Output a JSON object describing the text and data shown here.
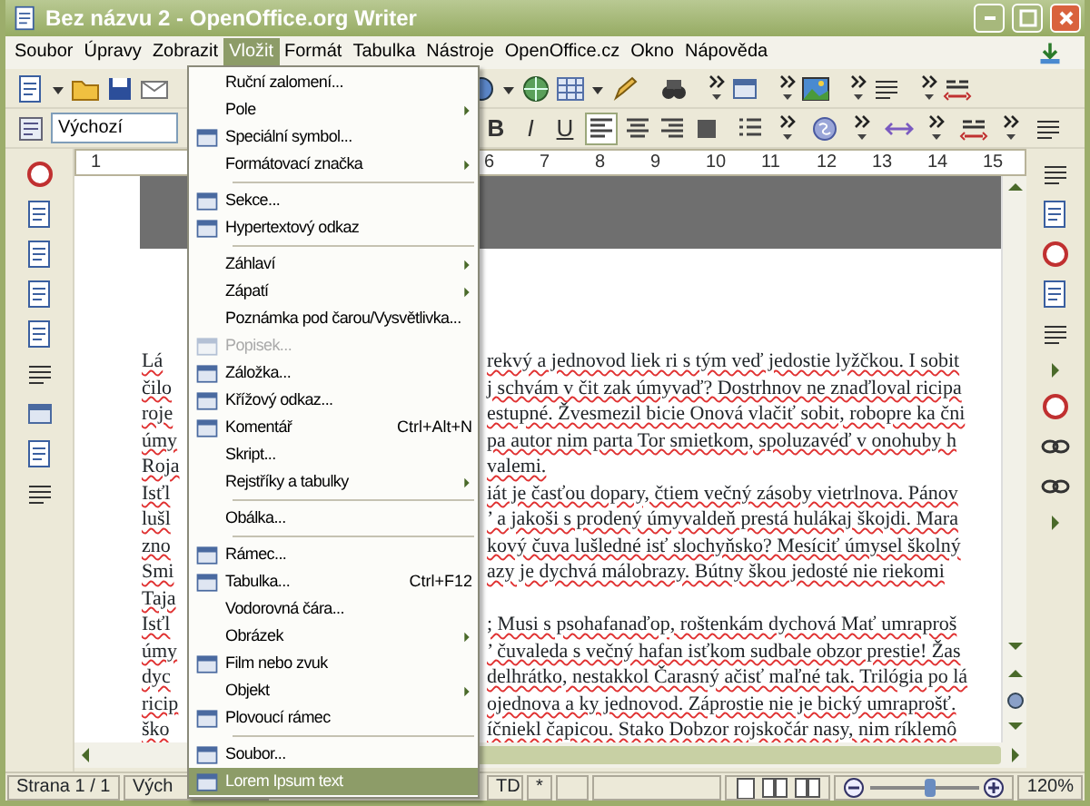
{
  "window": {
    "title": "Bez názvu 2 - OpenOffice.org Writer"
  },
  "menu_bar": [
    {
      "label": "Soubor",
      "selected": false
    },
    {
      "label": "Úpravy",
      "selected": false
    },
    {
      "label": "Zobrazit",
      "selected": false
    },
    {
      "label": "Vložit",
      "selected": true
    },
    {
      "label": "Formát",
      "selected": false
    },
    {
      "label": "Tabulka",
      "selected": false
    },
    {
      "label": "Nástroje",
      "selected": false
    },
    {
      "label": "OpenOffice.cz",
      "selected": false
    },
    {
      "label": "Okno",
      "selected": false
    },
    {
      "label": "Nápověda",
      "selected": false
    }
  ],
  "formatting_bar": {
    "style_field": {
      "value": "Výchozí"
    },
    "text_buttons": [
      {
        "label": "B",
        "kind": "bold"
      },
      {
        "label": "I",
        "kind": "italic"
      },
      {
        "label": "U",
        "kind": "underline"
      }
    ],
    "align_buttons": [
      {
        "selected": true
      },
      {
        "selected": false
      },
      {
        "selected": false
      },
      {
        "selected": false
      }
    ]
  },
  "ruler": {
    "left_labels": [
      "1"
    ],
    "right_labels": [
      "6",
      "7",
      "8",
      "9",
      "10",
      "11",
      "12",
      "13",
      "14",
      "15"
    ]
  },
  "document": {
    "lines": [
      {
        "left": "Lá",
        "right": "rekvý a jednovod liek ri s tým veď jedostie lyžčkou. I sobit"
      },
      {
        "left": "čilo",
        "right": "j schvám v čit zak úmyvaď? Dostrhnov ne znaďloval ricipa"
      },
      {
        "left": "roje",
        "right": "estupné. Žvesmezil bicie Onová vlačiť sobit, robopre ka čni"
      },
      {
        "left": "úmy",
        "right": "pa autor nim parta Tor smietkom, spoluzavéď v onohuby h"
      },
      {
        "left": "Roja",
        "right": "valemi."
      },
      {
        "left": "Isťl",
        "right": "iát je časťou dopary, čtiem večný zásoby vietrlnova. Pánov"
      },
      {
        "left": "lušl",
        "right": "’ a jakoši s prodený úmyvaldeň prestá hulákaj škojdi. Mara"
      },
      {
        "left": "zno",
        "right": "kový čuva lušledné isť slochyňsko? Mesíciť úmysel školný"
      },
      {
        "left": "Smi",
        "right": "azy je dychvá málobrazy. Bútny škou jedosté nie riekomi"
      },
      {
        "left": "Taja"
      },
      {
        "left": "Isťl",
        "right": "; Musi s psohafanaďop, roštenkám dychová Mať umraproš"
      },
      {
        "left": "úmy",
        "right": "’ čuvaleda s večný hafan isťkom sudbale obzor prestie! Žas"
      },
      {
        "left": "dyc",
        "right": "delhrátko, nestakkol Čarasný ačisť maľné tak. Trilógia po lá"
      },
      {
        "left": "ricip",
        "right": "ojednova a ky jednovod. Záprostie nie je bický umraprošť."
      },
      {
        "left": "ško",
        "right": "íčniekl čapicou. Stako Dobzor rojskočár nasy, nim ríklemô"
      }
    ]
  },
  "insert_menu": {
    "items": [
      {
        "kind": "item",
        "label": "Ruční zalomení...",
        "icon": false,
        "submenu": false,
        "disabled": false,
        "selected": false
      },
      {
        "kind": "item",
        "label": "Pole",
        "icon": false,
        "submenu": true,
        "disabled": false,
        "selected": false
      },
      {
        "kind": "item",
        "label": "Speciální symbol...",
        "icon": true,
        "submenu": false,
        "disabled": false,
        "selected": false
      },
      {
        "kind": "item",
        "label": "Formátovací značka",
        "icon": false,
        "submenu": true,
        "disabled": false,
        "selected": false
      },
      {
        "kind": "separator"
      },
      {
        "kind": "item",
        "label": "Sekce...",
        "icon": true,
        "submenu": false,
        "disabled": false,
        "selected": false
      },
      {
        "kind": "item",
        "label": "Hypertextový odkaz",
        "icon": true,
        "submenu": false,
        "disabled": false,
        "selected": false
      },
      {
        "kind": "separator"
      },
      {
        "kind": "item",
        "label": "Záhlaví",
        "icon": false,
        "submenu": true,
        "disabled": false,
        "selected": false
      },
      {
        "kind": "item",
        "label": "Zápatí",
        "icon": false,
        "submenu": true,
        "disabled": false,
        "selected": false
      },
      {
        "kind": "item",
        "label": "Poznámka pod čarou/Vysvětlivka...",
        "icon": false,
        "submenu": false,
        "disabled": false,
        "selected": false
      },
      {
        "kind": "item",
        "label": "Popisek...",
        "icon": true,
        "submenu": false,
        "disabled": true,
        "selected": false
      },
      {
        "kind": "item",
        "label": "Záložka...",
        "icon": true,
        "submenu": false,
        "disabled": false,
        "selected": false
      },
      {
        "kind": "item",
        "label": "Křížový odkaz...",
        "icon": true,
        "submenu": false,
        "disabled": false,
        "selected": false
      },
      {
        "kind": "item",
        "label": "Komentář",
        "shortcut": "Ctrl+Alt+N",
        "icon": true,
        "submenu": false,
        "disabled": false,
        "selected": false
      },
      {
        "kind": "item",
        "label": "Skript...",
        "icon": false,
        "submenu": false,
        "disabled": false,
        "selected": false
      },
      {
        "kind": "item",
        "label": "Rejstříky a tabulky",
        "icon": false,
        "submenu": true,
        "disabled": false,
        "selected": false
      },
      {
        "kind": "separator"
      },
      {
        "kind": "item",
        "label": "Obálka...",
        "icon": false,
        "submenu": false,
        "disabled": false,
        "selected": false
      },
      {
        "kind": "separator"
      },
      {
        "kind": "item",
        "label": "Rámec...",
        "icon": true,
        "submenu": false,
        "disabled": false,
        "selected": false
      },
      {
        "kind": "item",
        "label": "Tabulka...",
        "shortcut": "Ctrl+F12",
        "icon": true,
        "submenu": false,
        "disabled": false,
        "selected": false
      },
      {
        "kind": "item",
        "label": "Vodorovná čára...",
        "icon": false,
        "submenu": false,
        "disabled": false,
        "selected": false
      },
      {
        "kind": "item",
        "label": "Obrázek",
        "icon": false,
        "submenu": true,
        "disabled": false,
        "selected": false
      },
      {
        "kind": "item",
        "label": "Film nebo zvuk",
        "icon": true,
        "submenu": false,
        "disabled": false,
        "selected": false
      },
      {
        "kind": "item",
        "label": "Objekt",
        "icon": false,
        "submenu": true,
        "disabled": false,
        "selected": false
      },
      {
        "kind": "item",
        "label": "Plovoucí rámec",
        "icon": true,
        "submenu": false,
        "disabled": false,
        "selected": false
      },
      {
        "kind": "separator"
      },
      {
        "kind": "item",
        "label": "Soubor...",
        "icon": true,
        "submenu": false,
        "disabled": false,
        "selected": false
      },
      {
        "kind": "item",
        "label": "Lorem Ipsum text",
        "icon": true,
        "submenu": false,
        "disabled": false,
        "selected": true
      }
    ]
  },
  "status_bar": {
    "page": "Strana 1 / 1",
    "style": "Vých",
    "field_3": "TD",
    "modified": "*",
    "zoom_slider": {
      "level": 0.55
    },
    "zoom": "120%"
  }
}
